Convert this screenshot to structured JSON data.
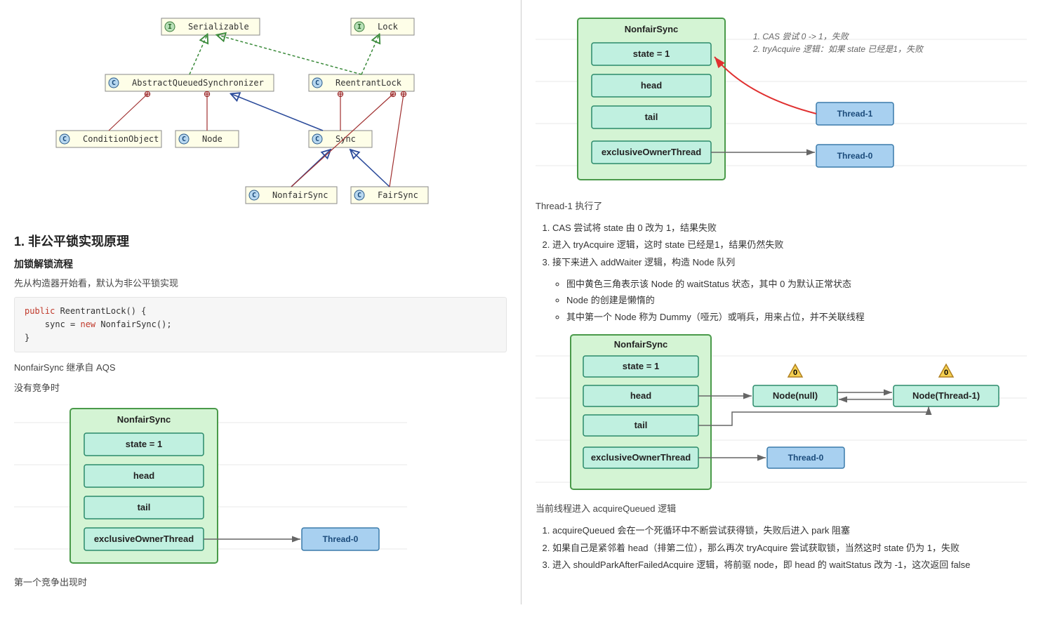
{
  "left": {
    "uml": {
      "serializable": "Serializable",
      "lock": "Lock",
      "aqs": "AbstractQueuedSynchronizer",
      "reentrant": "ReentrantLock",
      "condobj": "ConditionObject",
      "node": "Node",
      "sync": "Sync",
      "nonfair": "NonfairSync",
      "fair": "FairSync"
    },
    "h2": "1. 非公平锁实现原理",
    "h3": "加锁解锁流程",
    "p1": "先从构造器开始看，默认为非公平锁实现",
    "code": {
      "l1a": "public",
      "l1b": " ReentrantLock() {",
      "l2a": "    sync = ",
      "l2b": "new",
      "l2c": " NonfairSync();",
      "l3": "}"
    },
    "p2": "NonfairSync 继承自 AQS",
    "p3": "没有竞争时",
    "d1": {
      "title": "NonfairSync",
      "f1": "state = 1",
      "f2": "head",
      "f3": "tail",
      "f4": "exclusiveOwnerThread",
      "th0": "Thread-0"
    },
    "p4": "第一个竞争出现时"
  },
  "right": {
    "d2": {
      "title": "NonfairSync",
      "f1": "state = 1",
      "f2": "head",
      "f3": "tail",
      "f4": "exclusiveOwnerThread",
      "th0": "Thread-0",
      "th1": "Thread-1",
      "a1": "1. CAS 尝试 0 -> 1，失败",
      "a2": "2. tryAcquire 逻辑：如果 state 已经是1，失败"
    },
    "p_exec": "Thread-1 执行了",
    "ol1": {
      "i1": "CAS 尝试将 state 由 0 改为 1，结果失败",
      "i2": "进入 tryAcquire 逻辑，这时 state 已经是1，结果仍然失败",
      "i3": "接下来进入 addWaiter 逻辑，构造 Node 队列"
    },
    "ul1": {
      "i1": "图中黄色三角表示该 Node 的 waitStatus 状态，其中 0 为默认正常状态",
      "i2": "Node 的创建是懒惰的",
      "i3": "其中第一个 Node 称为 Dummy（哑元）或哨兵，用来占位，并不关联线程"
    },
    "d3": {
      "title": "NonfairSync",
      "f1": "state = 1",
      "f2": "head",
      "f3": "tail",
      "f4": "exclusiveOwnerThread",
      "th0": "Thread-0",
      "n1": "Node(null)",
      "n2": "Node(Thread-1)",
      "badge": "0"
    },
    "p_aq": "当前线程进入 acquireQueued 逻辑",
    "ol2": {
      "i1": "acquireQueued 会在一个死循环中不断尝试获得锁，失败后进入 park 阻塞",
      "i2": "如果自己是紧邻着 head（排第二位），那么再次 tryAcquire 尝试获取锁，当然这时 state 仍为 1，失败",
      "i3": "进入 shouldParkAfterFailedAcquire 逻辑，将前驱 node，即 head 的 waitStatus 改为 -1，这次返回 false"
    }
  }
}
